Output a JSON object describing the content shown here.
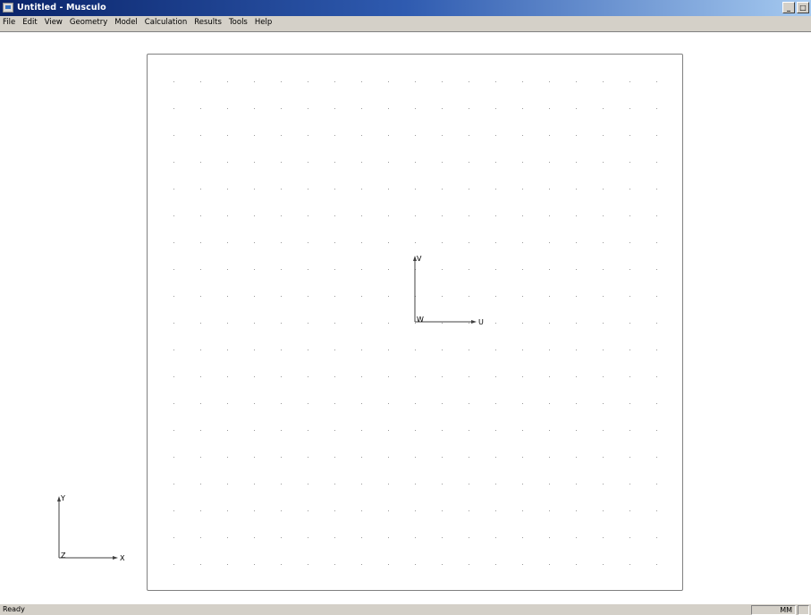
{
  "window": {
    "title": "Untitled - Musculo",
    "controls": {
      "minimize": "_",
      "maximize": "□"
    }
  },
  "menu": {
    "items": [
      "File",
      "Edit",
      "View",
      "Geometry",
      "Model",
      "Calculation",
      "Results",
      "Tools",
      "Help"
    ]
  },
  "canvas": {
    "local_axes": {
      "vertical_label": "V",
      "horizontal_label": "U",
      "origin_label": "W"
    },
    "global_axes": {
      "vertical_label": "Y",
      "horizontal_label": "X",
      "origin_label": "Z"
    }
  },
  "status": {
    "text": "Ready",
    "unit": "MM"
  },
  "colors": {
    "titlebar_start": "#0a246a",
    "titlebar_end": "#a6caf0",
    "chrome": "#d4d0c8",
    "grid_dot": "#9a9a9a",
    "axis": "#404040"
  }
}
